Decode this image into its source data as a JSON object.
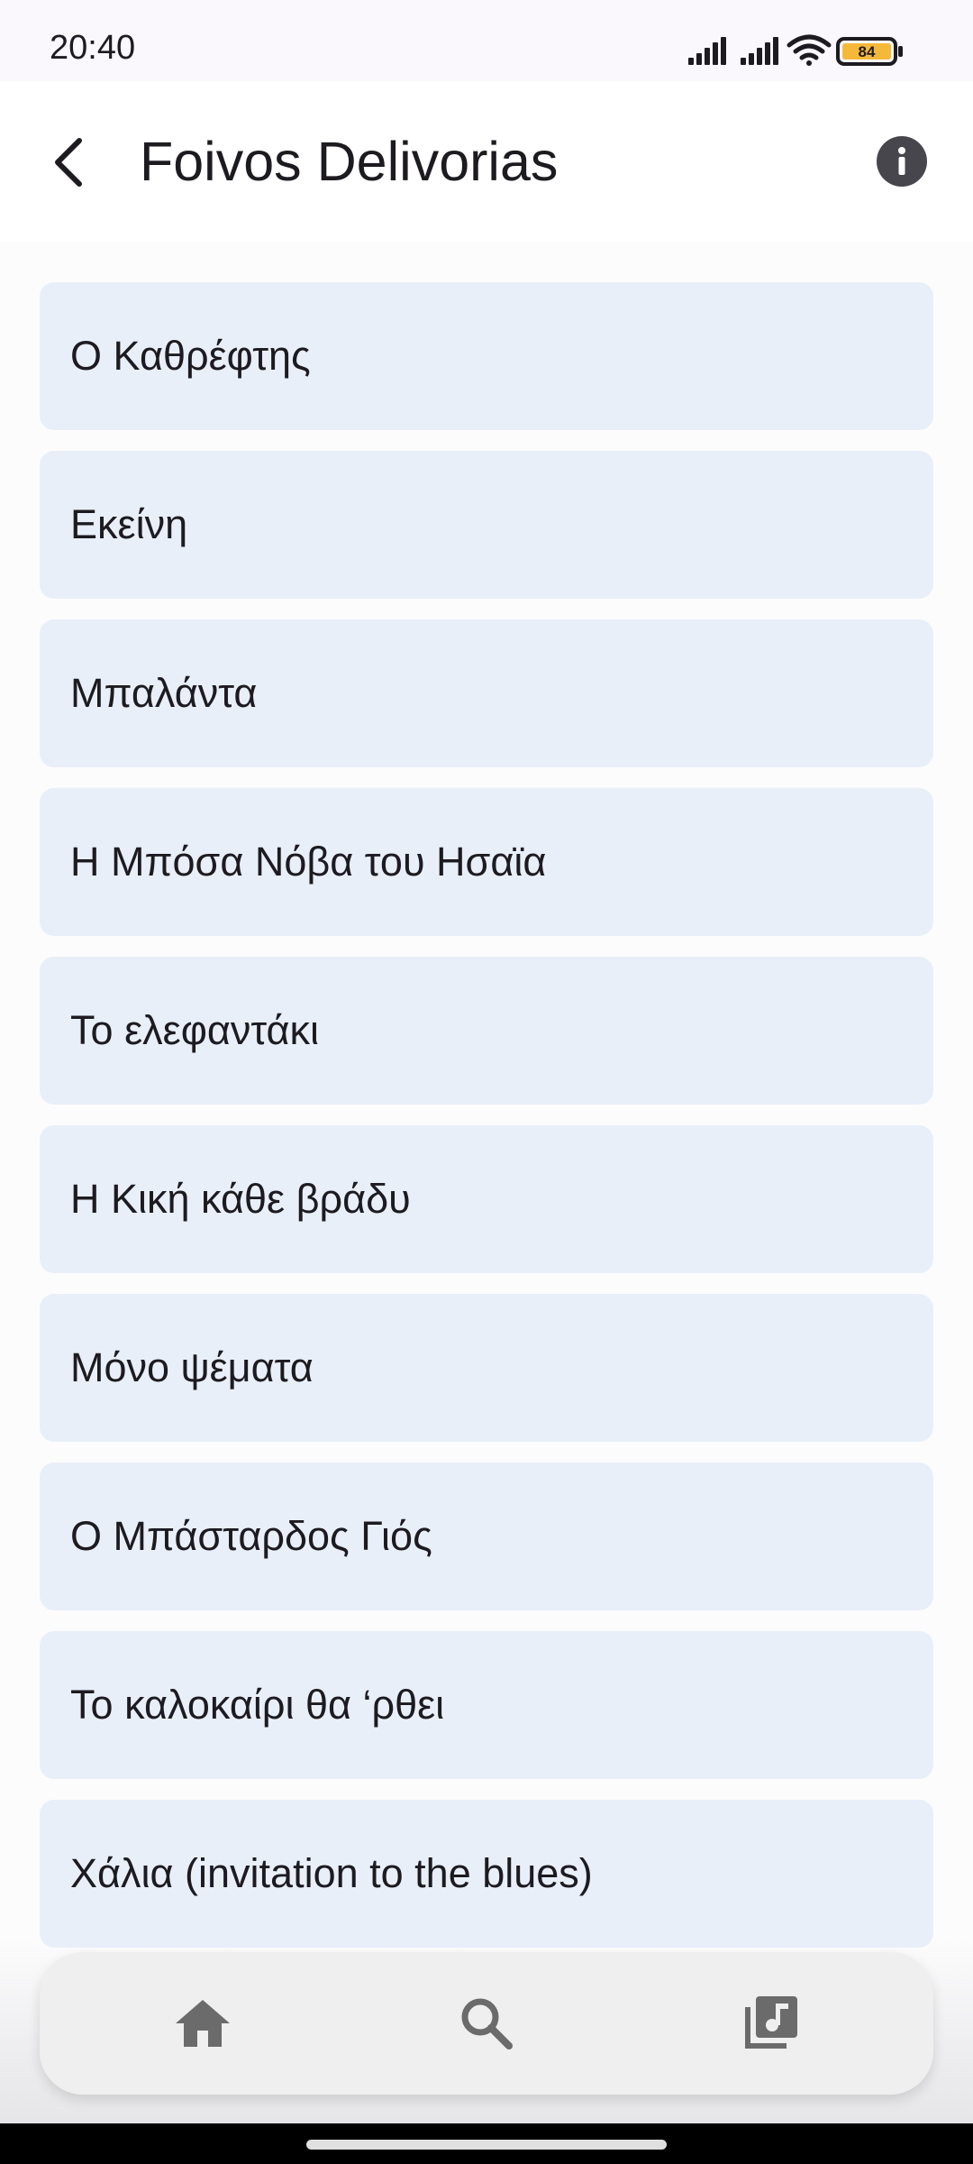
{
  "status_bar": {
    "time": "20:40",
    "battery_level": "84",
    "icons": [
      "signal-icon",
      "signal-icon",
      "wifi-icon",
      "battery-icon"
    ]
  },
  "app_bar": {
    "title": "Foivos Delivorias",
    "back_icon": "arrow-back-icon",
    "info_icon": "info-icon"
  },
  "tracks": [
    {
      "title": "Ο Καθρέφτης"
    },
    {
      "title": "Εκείνη"
    },
    {
      "title": "Μπαλάντα"
    },
    {
      "title": "Η Μπόσα Νόβα του Ησαϊα"
    },
    {
      "title": "Το ελεφαντάκι"
    },
    {
      "title": "Η Κική κάθε βράδυ"
    },
    {
      "title": "Μόνο ψέματα"
    },
    {
      "title": "Ο Μπάσταρδος Γιός"
    },
    {
      "title": "Το καλοκαίρι θα ‘ρθει"
    },
    {
      "title": "Χάλια (invitation to the blues)"
    }
  ],
  "bottom_nav": {
    "items": [
      {
        "icon": "home-icon"
      },
      {
        "icon": "search-icon"
      },
      {
        "icon": "library-music-icon"
      }
    ]
  },
  "colors": {
    "track_bg": "#e8eff9",
    "text": "#1d1b20",
    "nav_icon": "#6b6b6b",
    "battery_fill": "#f5b93a"
  }
}
